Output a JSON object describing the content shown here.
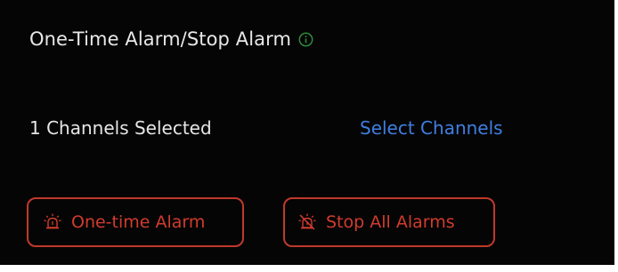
{
  "panel": {
    "title": "One-Time Alarm/Stop Alarm",
    "info_icon": "info-circle-icon",
    "channels_selected_text": "1 Channels Selected",
    "select_channels_link": "Select Channels",
    "buttons": {
      "one_time_alarm": {
        "label": "One-time Alarm",
        "icon": "alarm-siren-icon"
      },
      "stop_all_alarms": {
        "label": "Stop All Alarms",
        "icon": "alarm-siren-off-icon"
      }
    }
  },
  "colors": {
    "background": "#000000",
    "text": "#e6e6e6",
    "link": "#3f7fe0",
    "info_icon": "#2e8b3e",
    "alarm_red": "#c0392b"
  }
}
